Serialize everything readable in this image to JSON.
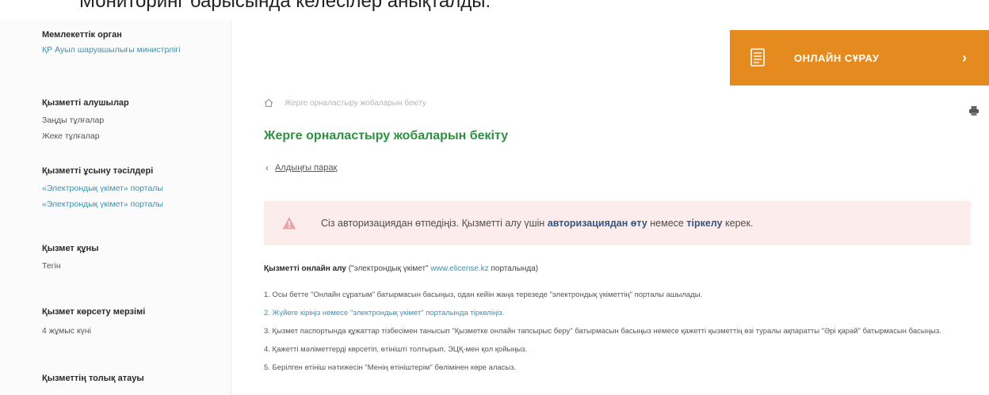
{
  "top_caption": "Мониторинг барысында келесілер анықталды:",
  "sidebar": {
    "authority_heading": "Мемлекеттік орган",
    "authority_value": "ҚР Ауыл шаруашылығы министрлігі",
    "recipients_heading": "Қызметті алушылар",
    "recipients": [
      "Заңды тұлғалар",
      "Жеке тұлғалар"
    ],
    "methods_heading": "Қызметті ұсыну тәсілдері",
    "methods": [
      "«Электрондық үкімет» порталы",
      "«Электрондық үкімет» порталы"
    ],
    "cost_heading": "Қызмет құны",
    "cost_value": "Тегін",
    "term_heading": "Қызмет көрсету мерзімі",
    "term_value": "4 жұмыс күні",
    "result_heading": "Қызметтің толық атауы"
  },
  "online_button": {
    "label": "ОНЛАЙН СҰРАУ",
    "icon": "document-icon",
    "color": "#e48a1e"
  },
  "breadcrumb": {
    "text": "Жерге орналастыру жобаларын бекіту"
  },
  "page_title": "Жерге орналастыру жобаларын бекіту",
  "back_link": "Алдыңғы парақ",
  "alert": {
    "text_before": "Сіз авторизациядан өтпедіңіз. Қызметті алу үшін",
    "auth_link": "авторизациядан өту",
    "text_middle": "немесе",
    "register_link": "тіркелу",
    "text_after": "керек."
  },
  "intro": {
    "bold": "Қызметті онлайн алу",
    "text": "(\"электрондық үкімет\"",
    "portal_link": "www.elicense.kz",
    "text_after": "порталында)"
  },
  "steps": [
    {
      "text": "1. Осы бетте \"Онлайн сұратым\" батырмасын басыңыз, одан кейін жаңа терезеде \"электрондық үкіметтің\" порталы ашылады."
    },
    {
      "link": "2. Жүйеге кіріңіз немесе \"электрондық үкімет\" порталында тіркеліңіз."
    },
    {
      "text": "3. Қызмет паспортында құжаттар тізбесімен танысып \"Қызметке онлайн тапсырыс беру\" батырмасын басыңыз немесе қажетті қызметтің өзі туралы ақпаратты \"Әрі қарай\" батырмасын басыңыз."
    },
    {
      "text": "4. Қажетті мәліметтерді көрсетіп, өтінішті толтырып, ЭЦҚ-мен қол қойыңыз."
    },
    {
      "text": "5. Берілген өтініш нәтижесін \"Менің өтініштерім\" бөлімінен көре аласыз."
    }
  ]
}
